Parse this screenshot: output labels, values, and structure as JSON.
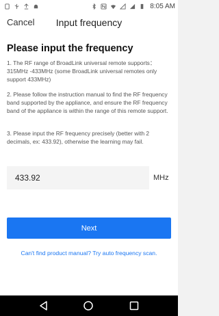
{
  "status_bar": {
    "left_icons": [
      "sim-icon",
      "usb-icon",
      "upload-icon",
      "android-icon"
    ],
    "right_icons": [
      "bluetooth-icon",
      "nfc-icon",
      "wifi-icon",
      "sim-off-icon",
      "signal-icon",
      "battery-icon"
    ],
    "time": "8:05 AM"
  },
  "nav": {
    "cancel_label": "Cancel",
    "title": "Input frequency"
  },
  "main": {
    "heading": "Please input the frequency",
    "paragraphs": [
      "1. The RF range of BroadLink universal remote supports：315MHz -433MHz (some BroadLink universal remotes only support 433MHz)",
      "2. Please follow the instruction manual to find the RF frequency band supported by the appliance, and ensure the RF frequency band of the appliance is within the range of this remote support.",
      "3. Please input the RF frequency precisely (better with 2 decimals, ex: 433.92), otherwise the learning may fail."
    ],
    "frequency_value": "433.92",
    "frequency_unit": "MHz",
    "next_label": "Next",
    "auto_scan_link": "Can't find product manual? Try auto frequency scan."
  },
  "colors": {
    "accent": "#1a76f2",
    "background": "#f2f2f2",
    "nav_bar": "#000000"
  }
}
